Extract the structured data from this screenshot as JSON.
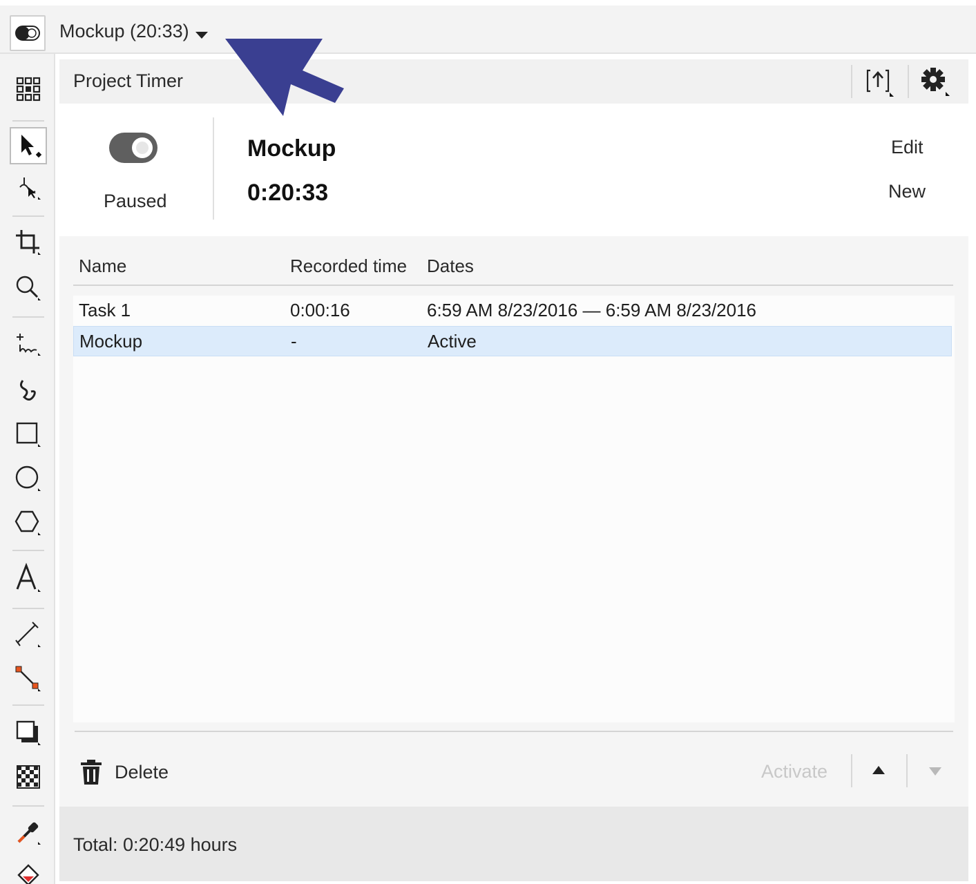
{
  "topbar": {
    "timer_title": "Mockup (20:33)",
    "icons": [
      "toggle-switch-icon",
      "caret-down-icon"
    ]
  },
  "annotation": {
    "arrow_color": "#3a3f91"
  },
  "toolbox": {
    "tools": [
      "options-grid-icon",
      "pick-tool-icon",
      "shape-tool-icon",
      "crop-tool-icon",
      "zoom-tool-icon",
      "freehand-tool-icon",
      "artistic-media-icon",
      "rectangle-tool-icon",
      "ellipse-tool-icon",
      "polygon-tool-icon",
      "text-tool-icon",
      "parallel-dimension-icon",
      "connector-tool-icon",
      "drop-shadow-icon",
      "transparency-icon",
      "eyedropper-icon",
      "interactive-fill-icon"
    ]
  },
  "panel": {
    "title": "Project Timer",
    "header_icons": [
      "export-icon",
      "settings-gear-icon"
    ],
    "status_label": "Paused",
    "project_name": "Mockup",
    "project_time": "0:20:33",
    "edit_label": "Edit",
    "new_label": "New",
    "table": {
      "columns": [
        "Name",
        "Recorded time",
        "Dates"
      ],
      "rows": [
        {
          "name": "Task 1",
          "recorded": "0:00:16",
          "dates": "6:59 AM 8/23/2016 — 6:59 AM 8/23/2016"
        },
        {
          "name": "Mockup",
          "recorded": "-",
          "dates": "Active"
        }
      ],
      "active_row_color": "#dcebfb"
    },
    "delete_label": "Delete",
    "activate_label": "Activate",
    "total": "Total: 0:20:49 hours"
  }
}
